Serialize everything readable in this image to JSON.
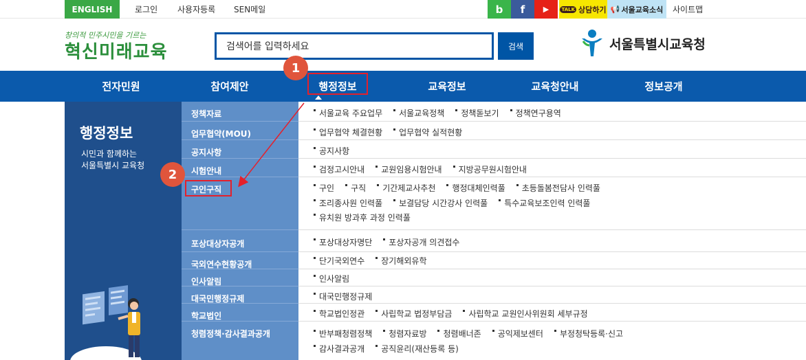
{
  "topbar": {
    "english": "ENGLISH",
    "links": [
      "로그인",
      "사용자등록",
      "SEN메일"
    ],
    "sns": [
      {
        "icon": "blog-icon",
        "glyph": "b",
        "color": "#3ab54a"
      },
      {
        "icon": "facebook-icon",
        "glyph": "f",
        "color": "#3b5b9c"
      },
      {
        "icon": "youtube-icon",
        "glyph": "▶",
        "color": "#e62117"
      }
    ],
    "consult": "상담하기",
    "news": "서울교육소식",
    "sitemap": "사이트맵"
  },
  "header": {
    "slogan": "창의적 민주시민을 기르는",
    "brand": "혁신미래교육",
    "search_placeholder": "검색어를 입력하세요",
    "search_button": "검색",
    "org_name": "서울특별시교육청"
  },
  "nav": {
    "items": [
      "전자민원",
      "참여제안",
      "행정정보",
      "교육정보",
      "교육청안내",
      "정보공개"
    ]
  },
  "intro": {
    "title": "행정정보",
    "desc_line1": "시민과 함께하는",
    "desc_line2": "서울특별시 교육청"
  },
  "menu": [
    {
      "category": "정책자료",
      "lines": [
        [
          "서울교육 주요업무",
          "서울교육정책",
          "정책돋보기",
          "정책연구용역"
        ]
      ]
    },
    {
      "category": "업무협약(MOU)",
      "lines": [
        [
          "업무협약 체결현황",
          "업무협약 실적현황"
        ]
      ]
    },
    {
      "category": "공지사항",
      "lines": [
        [
          "공지사항"
        ]
      ]
    },
    {
      "category": "시험안내",
      "lines": [
        [
          "검정고시안내",
          "교원임용시험안내",
          "지방공무원시험안내"
        ]
      ]
    },
    {
      "category": "구인구직",
      "lines": [
        [
          "구인",
          "구직",
          "기간제교사추천",
          "행정대체인력풀",
          "초등돌봄전담사 인력풀"
        ],
        [
          "조리종사원 인력풀",
          "보결담당 시간강사 인력풀",
          "특수교육보조인력 인력풀"
        ],
        [
          "유치원 방과후 과정 인력풀"
        ]
      ]
    },
    {
      "category": "포상대상자공개",
      "lines": [
        [
          "포상대상자명단",
          "포상자공개 의견접수"
        ]
      ]
    },
    {
      "category": "국외연수현황공개",
      "lines": [
        [
          "단기국외연수",
          "장기해외유학"
        ]
      ]
    },
    {
      "category": "인사알림",
      "lines": [
        [
          "인사알림"
        ]
      ]
    },
    {
      "category": "대국민행정규제",
      "lines": [
        [
          "대국민행정규제"
        ]
      ]
    },
    {
      "category": "학교법인",
      "lines": [
        [
          "학교법인정관",
          "사립학교 법정부담금",
          "사립학교 교원인사위원회 세부규정"
        ]
      ]
    },
    {
      "category": "청렴정책·감사결과공개",
      "lines": [
        [
          "반부패청렴정책",
          "청렴자료방",
          "청렴배너존",
          "공익제보센터",
          "부정청탁등록·신고"
        ],
        [
          "감사결과공개",
          "공직윤리(재산등록 등)"
        ]
      ]
    }
  ],
  "annotations": {
    "step1": "1",
    "step2": "2"
  }
}
